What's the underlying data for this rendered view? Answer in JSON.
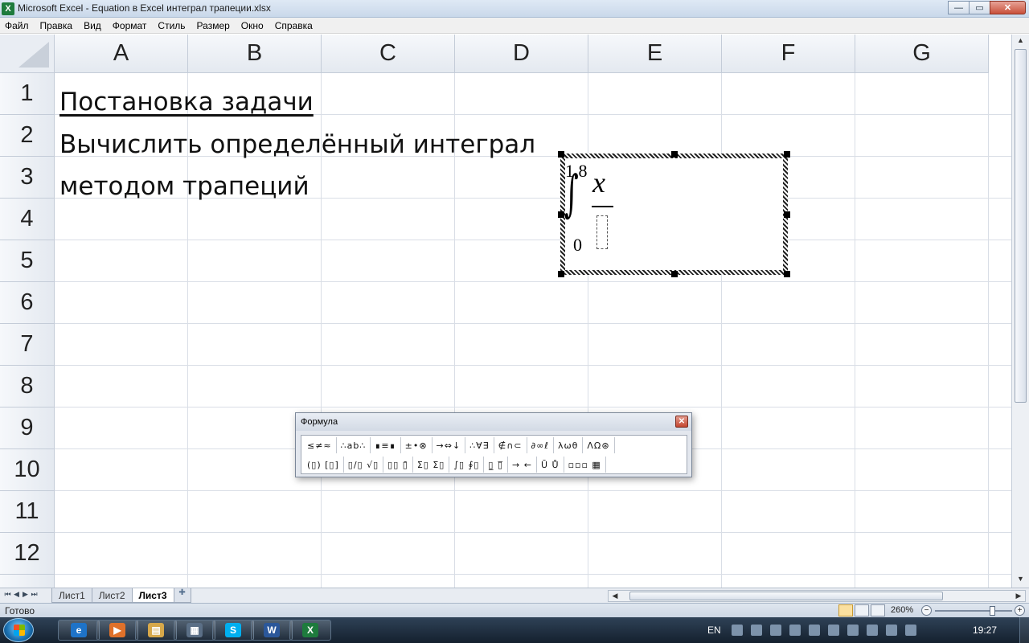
{
  "window": {
    "title": "Microsoft Excel - Equation в Excel интеграл трапеции.xlsx",
    "app_icon": "X",
    "buttons": {
      "minimize": "—",
      "maximize": "▭",
      "close": "✕"
    }
  },
  "menu": [
    "Файл",
    "Правка",
    "Вид",
    "Формат",
    "Стиль",
    "Размер",
    "Окно",
    "Справка"
  ],
  "columns": [
    "A",
    "B",
    "C",
    "D",
    "E",
    "F",
    "G"
  ],
  "rows": [
    "1",
    "2",
    "3",
    "4",
    "5",
    "6",
    "7",
    "8",
    "9",
    "10",
    "11",
    "12"
  ],
  "cells": {
    "A2": "Постановка задачи",
    "A3": "Вычислить определённый интеграл",
    "A4": "методом трапеций"
  },
  "equation": {
    "upper_limit": "1,8",
    "integral_symbol": "∫",
    "lower_limit": "0",
    "numerator": "x"
  },
  "formula_toolbar": {
    "title": "Формула",
    "close": "✕",
    "row1": [
      "≤≠≈",
      "∴ab∴",
      "∎≡∎",
      "±•⊗",
      "→⇔↓",
      "∴∀∃",
      "∉∩⊂",
      "∂∞ℓ",
      "λωθ",
      "ΛΩ⊛"
    ],
    "row2": [
      "(▯) [▯]",
      "▯/▯ √▯",
      "▯▯ ▯̄",
      "Σ▯ Σ▯",
      "∫▯ ∮▯",
      "▯̲ ▯̅",
      "→ ←",
      "Ū Ů",
      "▫▫▫ ▦"
    ]
  },
  "sheet_tabs": {
    "nav": [
      "⏮",
      "◀",
      "▶",
      "⏭"
    ],
    "tabs": [
      "Лист1",
      "Лист2",
      "Лист3"
    ],
    "active": "Лист3"
  },
  "status": {
    "ready": "Готово",
    "zoom": "260%",
    "zoom_minus": "−",
    "zoom_plus": "+"
  },
  "taskbar": {
    "apps": [
      {
        "name": "ie-icon",
        "glyph": "e",
        "color": "#1e73c8"
      },
      {
        "name": "media-player-icon",
        "glyph": "▶",
        "color": "#e0712a"
      },
      {
        "name": "explorer-icon",
        "glyph": "▤",
        "color": "#d7a84a"
      },
      {
        "name": "calculator-icon",
        "glyph": "▦",
        "color": "#5b6f86"
      },
      {
        "name": "skype-icon",
        "glyph": "S",
        "color": "#00aff0"
      },
      {
        "name": "word-icon",
        "glyph": "W",
        "color": "#2b579a"
      },
      {
        "name": "excel-icon",
        "glyph": "X",
        "color": "#1e7b3d"
      }
    ],
    "language": "EN",
    "clock": "19:27"
  }
}
